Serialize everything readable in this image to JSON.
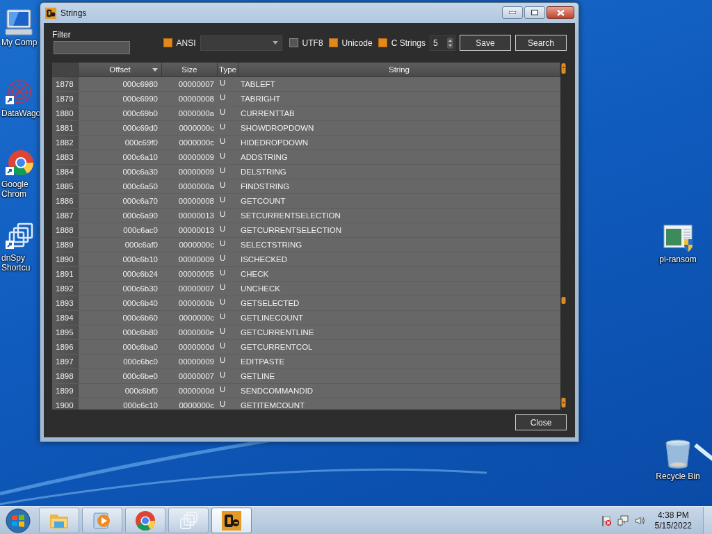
{
  "desktop": {
    "left_icons": [
      {
        "label": "My Comp",
        "kind": "computer"
      },
      {
        "label": "DataWago",
        "kind": "datawagon"
      },
      {
        "label": "Google Chrom",
        "kind": "chrome"
      },
      {
        "label": "dnSpy Shortcu",
        "kind": "stack"
      }
    ],
    "right_icons": [
      {
        "label": "pi-ransom",
        "kind": "installer"
      },
      {
        "label": "Recycle Bin",
        "kind": "bin"
      }
    ]
  },
  "window": {
    "title": "Strings",
    "filter": {
      "label": "Filter"
    },
    "toolbar": [
      {
        "kind": "checkbox",
        "label": "ANSI",
        "checked": true
      },
      {
        "kind": "dropdown"
      },
      {
        "kind": "checkbox",
        "label": "UTF8",
        "checked": false
      },
      {
        "kind": "checkbox",
        "label": "Unicode",
        "checked": true
      },
      {
        "kind": "checkbox",
        "label": "C Strings",
        "checked": true
      },
      {
        "kind": "spinner",
        "value": "5"
      },
      {
        "kind": "button",
        "label": "Save"
      },
      {
        "kind": "button",
        "label": "Search"
      }
    ],
    "table": {
      "columns": [
        {
          "label": "Offset",
          "sorted": true
        },
        {
          "label": "Size",
          "sorted": false
        },
        {
          "label": "Type",
          "sorted": false
        },
        {
          "label": "String",
          "sorted": false
        }
      ],
      "rows": [
        {
          "index": "1878",
          "offset": "000c6980",
          "size": "00000007",
          "type": "U",
          "string": "TABLEFT"
        },
        {
          "index": "1879",
          "offset": "000c6990",
          "size": "00000008",
          "type": "U",
          "string": "TABRIGHT"
        },
        {
          "index": "1880",
          "offset": "000c69b0",
          "size": "0000000a",
          "type": "U",
          "string": "CURRENTTAB"
        },
        {
          "index": "1881",
          "offset": "000c69d0",
          "size": "0000000c",
          "type": "U",
          "string": "SHOWDROPDOWN"
        },
        {
          "index": "1882",
          "offset": "000c69f0",
          "size": "0000000c",
          "type": "U",
          "string": "HIDEDROPDOWN"
        },
        {
          "index": "1883",
          "offset": "000c6a10",
          "size": "00000009",
          "type": "U",
          "string": "ADDSTRING"
        },
        {
          "index": "1884",
          "offset": "000c6a30",
          "size": "00000009",
          "type": "U",
          "string": "DELSTRING"
        },
        {
          "index": "1885",
          "offset": "000c6a50",
          "size": "0000000a",
          "type": "U",
          "string": "FINDSTRING"
        },
        {
          "index": "1886",
          "offset": "000c6a70",
          "size": "00000008",
          "type": "U",
          "string": "GETCOUNT"
        },
        {
          "index": "1887",
          "offset": "000c6a90",
          "size": "00000013",
          "type": "U",
          "string": "SETCURRENTSELECTION"
        },
        {
          "index": "1888",
          "offset": "000c6ac0",
          "size": "00000013",
          "type": "U",
          "string": "GETCURRENTSELECTION"
        },
        {
          "index": "1889",
          "offset": "000c6af0",
          "size": "0000000c",
          "type": "U",
          "string": "SELECTSTRING"
        },
        {
          "index": "1890",
          "offset": "000c6b10",
          "size": "00000009",
          "type": "U",
          "string": "ISCHECKED"
        },
        {
          "index": "1891",
          "offset": "000c6b24",
          "size": "00000005",
          "type": "U",
          "string": "CHECK"
        },
        {
          "index": "1892",
          "offset": "000c6b30",
          "size": "00000007",
          "type": "U",
          "string": "UNCHECK"
        },
        {
          "index": "1893",
          "offset": "000c6b40",
          "size": "0000000b",
          "type": "U",
          "string": "GETSELECTED"
        },
        {
          "index": "1894",
          "offset": "000c6b60",
          "size": "0000000c",
          "type": "U",
          "string": "GETLINECOUNT"
        },
        {
          "index": "1895",
          "offset": "000c6b80",
          "size": "0000000e",
          "type": "U",
          "string": "GETCURRENTLINE"
        },
        {
          "index": "1896",
          "offset": "000c6ba0",
          "size": "0000000d",
          "type": "U",
          "string": "GETCURRENTCOL"
        },
        {
          "index": "1897",
          "offset": "000c6bc0",
          "size": "00000009",
          "type": "U",
          "string": "EDITPASTE"
        },
        {
          "index": "1898",
          "offset": "000c6be0",
          "size": "00000007",
          "type": "U",
          "string": "GETLINE"
        },
        {
          "index": "1899",
          "offset": "000c6bf0",
          "size": "0000000d",
          "type": "U",
          "string": "SENDCOMMANDID"
        },
        {
          "index": "1900",
          "offset": "000c6c10",
          "size": "0000000c",
          "type": "U",
          "string": "GETITEMCOUNT"
        }
      ]
    },
    "footer_buttons": [
      "Close"
    ]
  },
  "taskbar": {
    "items": [
      {
        "kind": "folder",
        "active": false
      },
      {
        "kind": "media",
        "active": false
      },
      {
        "kind": "chrome",
        "active": false
      },
      {
        "kind": "stack",
        "active": false
      },
      {
        "kind": "app",
        "active": true
      }
    ],
    "tray": {
      "time": "4:38 PM",
      "date": "5/15/2022"
    }
  }
}
